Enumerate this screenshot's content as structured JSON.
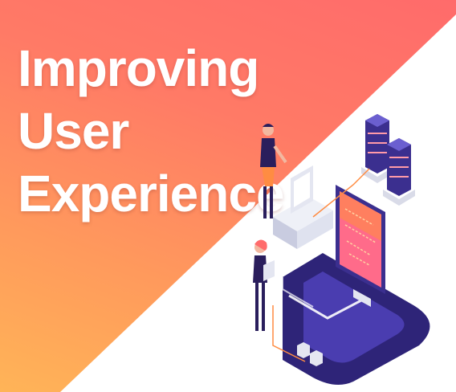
{
  "headline": {
    "line1": "Improving",
    "line2": "User",
    "line3": "Experience"
  },
  "colors": {
    "gradient_top": "#ff6b6b",
    "gradient_bottom": "#ffb457",
    "accent_purple": "#3b2f8f",
    "accent_orange": "#ff8c42",
    "screen_pink": "#ff6b8a",
    "text": "#ffffff"
  },
  "illustration": {
    "icons": [
      "server-rack-icon",
      "server-rack-icon",
      "desktop-computer-icon",
      "monitor-icon",
      "person-icon",
      "person-icon",
      "u-track-icon"
    ]
  }
}
